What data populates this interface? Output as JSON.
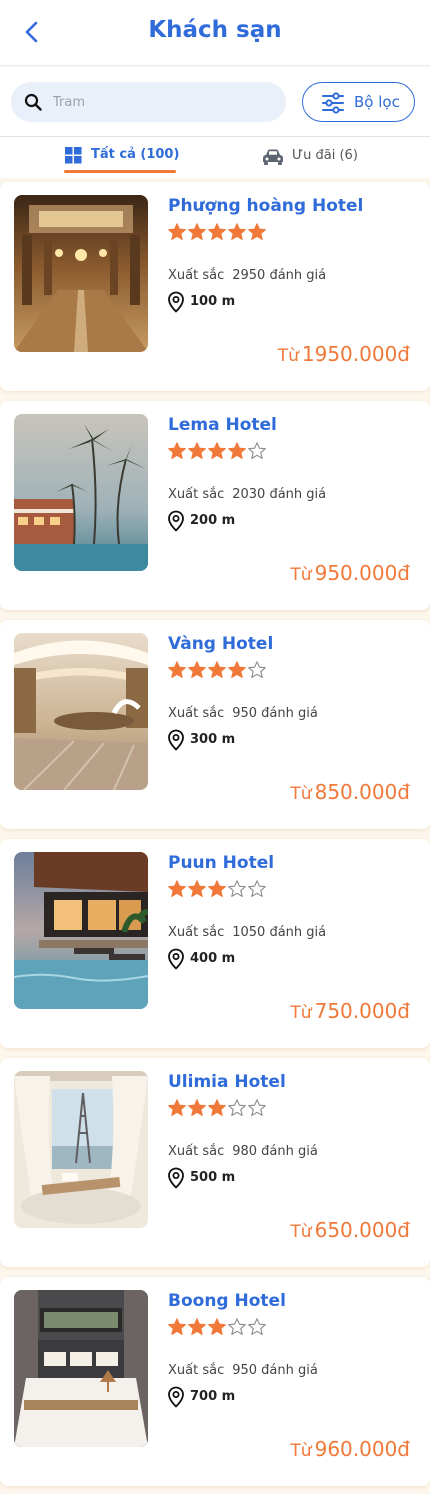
{
  "header": {
    "title": "Khách sạn"
  },
  "search": {
    "placeholder": "Tram",
    "filter_label": "Bộ lọc"
  },
  "tabs": [
    {
      "label": "Tất cả (100)",
      "active": true
    },
    {
      "label": "Ưu đãi (6)",
      "active": false
    }
  ],
  "colors": {
    "accent": "#2f6bd9",
    "price": "#f0793a",
    "star": "#f0793a"
  },
  "common": {
    "rating_word": "Xuất sắc",
    "price_prefix": "Từ"
  },
  "hotels": [
    {
      "name": "Phượng hoàng Hotel",
      "stars": 5,
      "reviews": "2950 đánh giá",
      "distance": "100 m",
      "price": "1950.000đ",
      "image": "lobby"
    },
    {
      "name": "Lema Hotel",
      "stars": 4,
      "reviews": "2030 đánh giá",
      "distance": "200 m",
      "price": "950.000đ",
      "image": "palm-pool"
    },
    {
      "name": "Vàng Hotel",
      "stars": 4,
      "reviews": "950 đánh giá",
      "distance": "300 m",
      "price": "850.000đ",
      "image": "modern-lobby"
    },
    {
      "name": "Puun Hotel",
      "stars": 3,
      "reviews": "1050 đánh giá",
      "distance": "400 m",
      "price": "750.000đ",
      "image": "infinity-pool"
    },
    {
      "name": "Ulimia Hotel",
      "stars": 3,
      "reviews": "980 đánh giá",
      "distance": "500 m",
      "price": "650.000đ",
      "image": "eiffel-room"
    },
    {
      "name": "Boong Hotel",
      "stars": 3,
      "reviews": "950 đánh giá",
      "distance": "700 m",
      "price": "960.000đ",
      "image": "bedroom"
    }
  ]
}
